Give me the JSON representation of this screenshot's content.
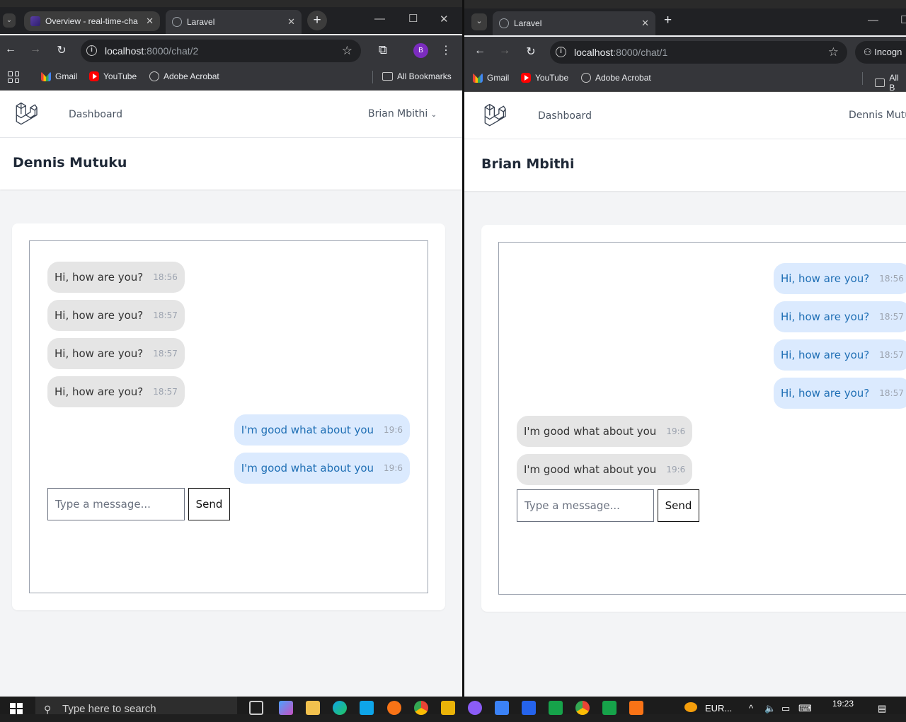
{
  "left_window": {
    "tabs": [
      {
        "title": "Overview - real-time-cha",
        "active": false
      },
      {
        "title": "Laravel",
        "active": true
      }
    ],
    "url_host": "localhost",
    "url_path": ":8000/chat/2",
    "profile_initial": "B",
    "bookmarks": [
      "Gmail",
      "YouTube",
      "Adobe Acrobat"
    ],
    "all_bookmarks": "All Bookmarks",
    "nav": {
      "dashboard": "Dashboard",
      "user": "Brian Mbithi"
    },
    "header_title": "Dennis Mutuku",
    "messages": [
      {
        "text": "Hi, how are you?",
        "time": "18:56",
        "side": "left"
      },
      {
        "text": "Hi, how are you?",
        "time": "18:57",
        "side": "left"
      },
      {
        "text": "Hi, how are you?",
        "time": "18:57",
        "side": "left"
      },
      {
        "text": "Hi, how are you?",
        "time": "18:57",
        "side": "left"
      },
      {
        "text": "I'm good what about you",
        "time": "19:6",
        "side": "right"
      },
      {
        "text": "I'm good what about you",
        "time": "19:6",
        "side": "right"
      }
    ],
    "input_placeholder": "Type a message...",
    "send_label": "Send"
  },
  "right_window": {
    "tabs": [
      {
        "title": "Laravel",
        "active": true
      }
    ],
    "url_host": "localhost",
    "url_path": ":8000/chat/1",
    "incognito_label": "Incogn",
    "bookmarks": [
      "Gmail",
      "YouTube",
      "Adobe Acrobat"
    ],
    "all_bookmarks": "All B",
    "nav": {
      "dashboard": "Dashboard",
      "user": "Dennis Mutul"
    },
    "header_title": "Brian Mbithi",
    "messages": [
      {
        "text": "Hi, how are you?",
        "time": "18:56",
        "side": "right"
      },
      {
        "text": "Hi, how are you?",
        "time": "18:57",
        "side": "right"
      },
      {
        "text": "Hi, how are you?",
        "time": "18:57",
        "side": "right"
      },
      {
        "text": "Hi, how are you?",
        "time": "18:57",
        "side": "right"
      },
      {
        "text": "I'm good what about you",
        "time": "19:6",
        "side": "left"
      },
      {
        "text": "I'm good what about you",
        "time": "19:6",
        "side": "left"
      }
    ],
    "input_placeholder": "Type a message...",
    "send_label": "Send"
  },
  "taskbar": {
    "search_placeholder": "Type here to search",
    "currency": "EUR...",
    "time": "19:23"
  },
  "colors": {
    "bubble_sent": "#dbeafe",
    "bubble_sent_text": "#1f6fb5",
    "bubble_received": "#e5e5e5",
    "page_bg": "#f3f4f6",
    "chrome_dark": "#35363a"
  }
}
